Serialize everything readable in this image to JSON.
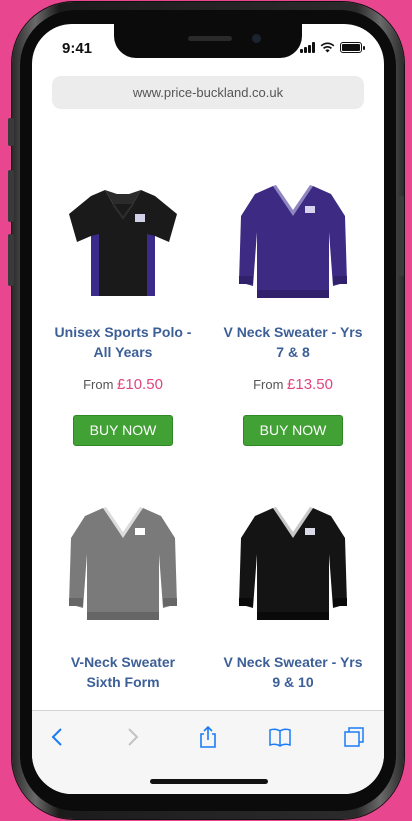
{
  "status_bar": {
    "time": "9:41"
  },
  "browser": {
    "url": "www.price-buckland.co.uk"
  },
  "products": [
    {
      "title_line1": "Unisex Sports Polo -",
      "title_line2": "All Years",
      "price_prefix": "From",
      "price": "£10.50",
      "button": "BUY NOW",
      "image": "black-sports-polo-shirt"
    },
    {
      "title_line1": "V Neck Sweater - Yrs",
      "title_line2": "7 & 8",
      "price_prefix": "From",
      "price": "£13.50",
      "button": "BUY NOW",
      "image": "purple-v-neck-sweater"
    },
    {
      "title_line1": "V-Neck Sweater",
      "title_line2": "Sixth Form",
      "image": "grey-v-neck-sweater"
    },
    {
      "title_line1": "V Neck Sweater - Yrs",
      "title_line2": "9 & 10",
      "image": "black-v-neck-sweater"
    }
  ],
  "toolbar": {
    "icons": [
      "back-icon",
      "forward-icon",
      "share-icon",
      "bookmarks-icon",
      "tabs-icon"
    ]
  },
  "colors": {
    "background": "#e8478f",
    "link": "#3c5f97",
    "price": "#e0457f",
    "button": "#41a135",
    "browser_accent": "#1a7cf5"
  }
}
